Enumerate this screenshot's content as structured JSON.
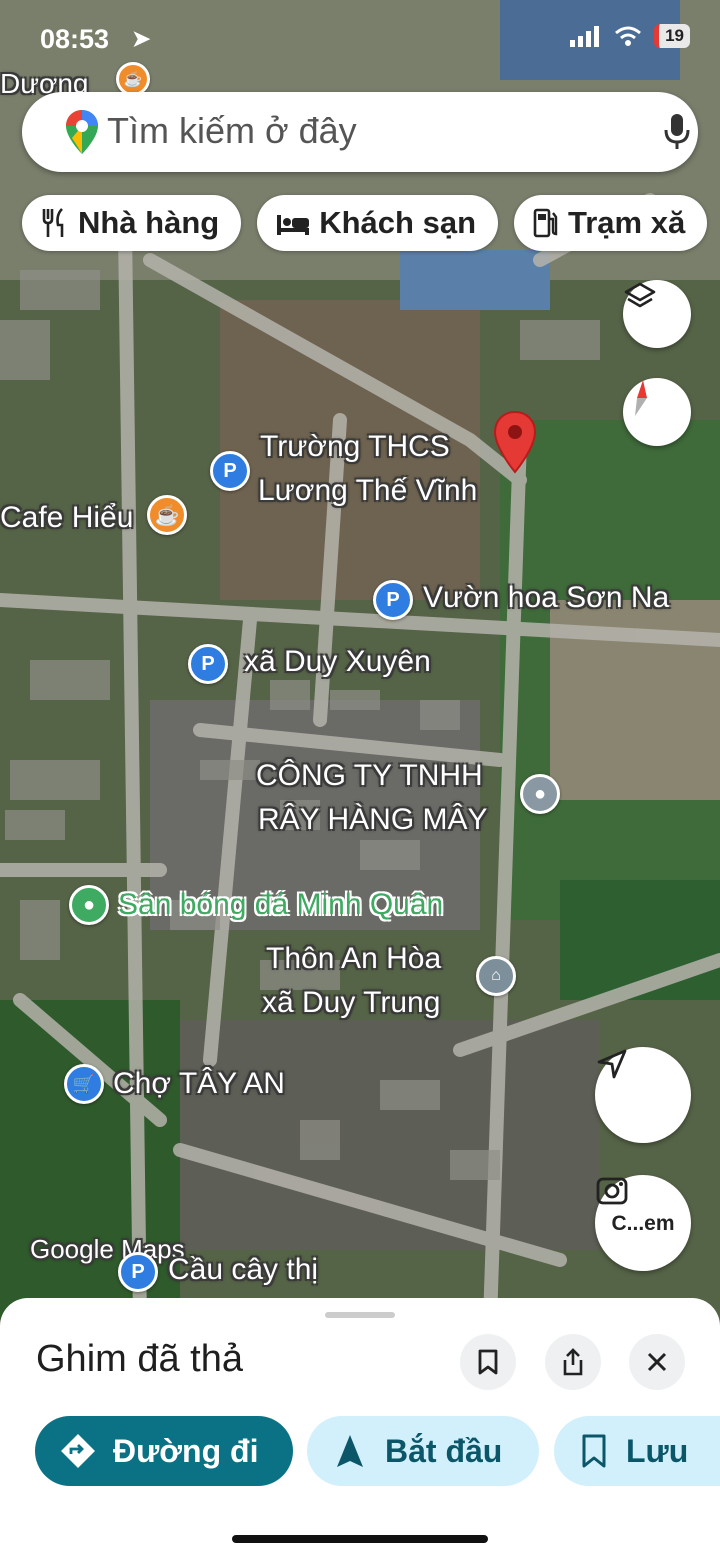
{
  "status": {
    "time": "08:53",
    "battery": "19"
  },
  "search": {
    "placeholder": "Tìm kiếm ở đây"
  },
  "chips": [
    {
      "label": "Nhà hàng",
      "icon": "restaurant-icon"
    },
    {
      "label": "Khách sạn",
      "icon": "hotel-icon"
    },
    {
      "label": "Trạm xă",
      "icon": "gas-station-icon"
    }
  ],
  "map": {
    "labels": {
      "duong": "Dương",
      "truong_l1": "Trường THCS",
      "truong_l2": "Lương Thế Vĩnh",
      "cafe": "Cafe Hiểu",
      "vuon_hoa": "Vườn hoa Sơn Na",
      "xa_duy_xuyen": "xã Duy Xuyên",
      "cong_ty_l1": "CÔNG TY TNHH",
      "cong_ty_l2": "RÂY HÀNG MÂY",
      "san_bong": "Sân bóng đá Minh Quân",
      "thon_l1": "Thôn An Hòa",
      "thon_l2": "xã Duy Trung",
      "cho": "Chợ TÂY AN",
      "cau": "Cầu cây thị",
      "watermark": "Google Maps"
    },
    "camera_label": "C...em"
  },
  "sheet": {
    "title": "Ghim đã thả",
    "actions": {
      "directions": "Đường đi",
      "start": "Bắt đầu",
      "save": "Lưu"
    }
  },
  "colors": {
    "directions_bg": "#0b7285",
    "chip_bg": "#d2f0fb",
    "pin_red": "#e53935",
    "poi_blue": "#2f7de1",
    "poi_orange": "#f08c2a"
  }
}
